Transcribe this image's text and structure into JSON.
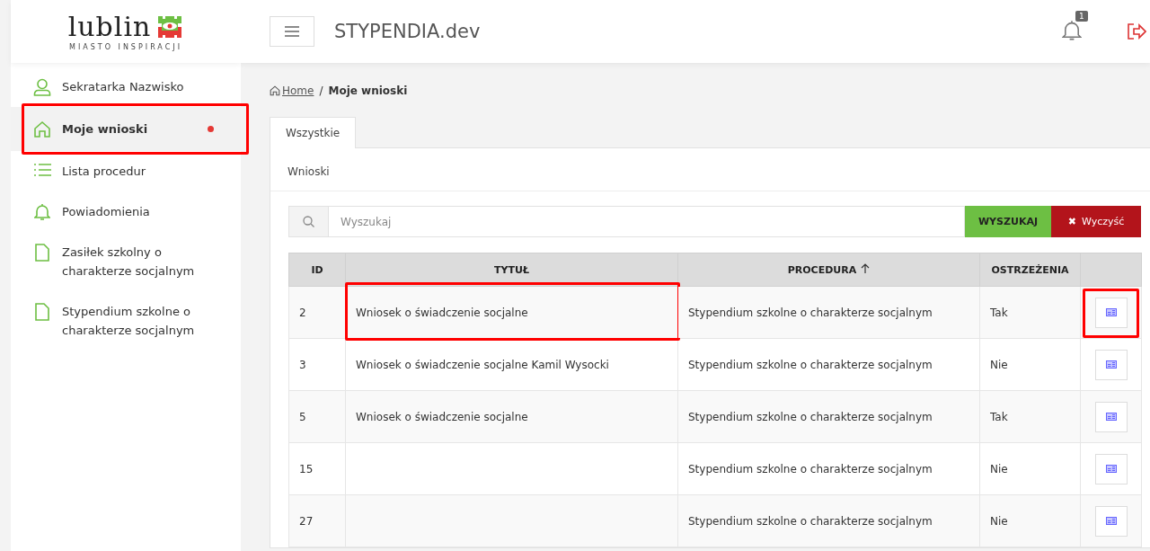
{
  "logo": {
    "wordmark": "lublin",
    "tagline": "MIASTO INSPIRACJI"
  },
  "header": {
    "title": "STYPENDIA.dev",
    "notification_count": "1"
  },
  "sidebar": {
    "items": [
      {
        "kind": "user",
        "label": "Sekratarka Nazwisko",
        "selected": false,
        "dot": false,
        "highlighted": false
      },
      {
        "kind": "home",
        "label": "Moje wnioski",
        "selected": true,
        "dot": true,
        "highlighted": true
      },
      {
        "kind": "list",
        "label": "Lista procedur",
        "selected": false,
        "dot": false,
        "highlighted": false
      },
      {
        "kind": "bell",
        "label": "Powiadomienia",
        "selected": false,
        "dot": false,
        "highlighted": false
      },
      {
        "kind": "file",
        "label": "Zasiłek szkolny o charakterze socjalnym",
        "selected": false,
        "dot": false,
        "highlighted": false
      },
      {
        "kind": "file",
        "label": "Stypendium szkolne o charakterze socjalnym",
        "selected": false,
        "dot": false,
        "highlighted": false
      }
    ]
  },
  "breadcrumb": {
    "home": "Home",
    "separator": "/",
    "current": "Moje wnioski"
  },
  "tabs": [
    {
      "label": "Wszystkie",
      "selected": true
    }
  ],
  "card": {
    "title": "Wnioski",
    "search": {
      "placeholder": "Wyszukaj",
      "search_button": "WYSZUKAJ",
      "clear_button": "Wyczyść",
      "clear_icon": "✖"
    },
    "table": {
      "columns": [
        {
          "label": "ID",
          "sorted": false
        },
        {
          "label": "TYTUŁ",
          "sorted": false
        },
        {
          "label": "PROCEDURA",
          "sorted": true
        },
        {
          "label": "OSTRZEŻENIA",
          "sorted": false
        },
        {
          "sorted": false
        }
      ],
      "rows": [
        {
          "id": "2",
          "title": "Wniosek o świadczenie socjalne",
          "procedure": "Stypendium szkolne o charakterze socjalnym",
          "warnings": "Tak",
          "title_highlighted": true,
          "action_highlighted": true
        },
        {
          "id": "3",
          "title": "Wniosek o świadczenie socjalne Kamil Wysocki",
          "procedure": "Stypendium szkolne o charakterze socjalnym",
          "warnings": "Nie",
          "title_highlighted": false,
          "action_highlighted": false
        },
        {
          "id": "5",
          "title": "Wniosek o świadczenie socjalne",
          "procedure": "Stypendium szkolne o charakterze socjalnym",
          "warnings": "Tak",
          "title_highlighted": false,
          "action_highlighted": false
        },
        {
          "id": "15",
          "procedure": "Stypendium szkolne o charakterze socjalnym",
          "warnings": "Nie",
          "title_highlighted": false,
          "action_highlighted": false
        },
        {
          "id": "27",
          "procedure": "Stypendium szkolne o charakterze socjalnym",
          "warnings": "Nie",
          "title_highlighted": false,
          "action_highlighted": false
        }
      ]
    }
  }
}
